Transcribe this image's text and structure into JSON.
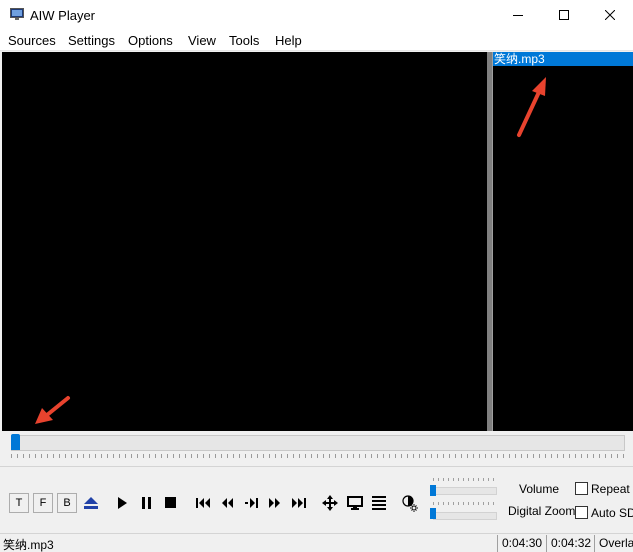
{
  "window": {
    "title": "AIW Player"
  },
  "menu": [
    "Sources",
    "Settings",
    "Options",
    "View",
    "Tools",
    "Help"
  ],
  "playlist": {
    "items": [
      {
        "label": "笑纳.mp3",
        "selected": true
      }
    ]
  },
  "seek": {
    "progress": 0.0
  },
  "toggles": [
    "T",
    "F",
    "B"
  ],
  "sliders": {
    "volume_label": "Volume",
    "zoom_label": "Digital Zoom",
    "volume_level": 0.0,
    "zoom_level": 0.0
  },
  "options": {
    "repeat_label": "Repeat",
    "auto_sd_label": "Auto SD",
    "repeat_checked": false,
    "auto_sd_checked": false
  },
  "status": {
    "file": "笑纳.mp3",
    "elapsed": "0:04:30",
    "duration": "0:04:32",
    "overlay": "Overlay"
  },
  "colors": {
    "accent": "#0078d7",
    "annotation": "#e8432e",
    "video_bg": "#000000"
  },
  "icons": [
    "app-icon",
    "minimize-icon",
    "maximize-icon",
    "close-icon",
    "eject-icon",
    "play-icon",
    "pause-icon",
    "stop-icon",
    "skip-start-icon",
    "rewind-icon",
    "frame-step-icon",
    "fast-forward-icon",
    "skip-end-icon",
    "move-icon",
    "monitor-icon",
    "playlist-icon",
    "brightness-icon"
  ]
}
